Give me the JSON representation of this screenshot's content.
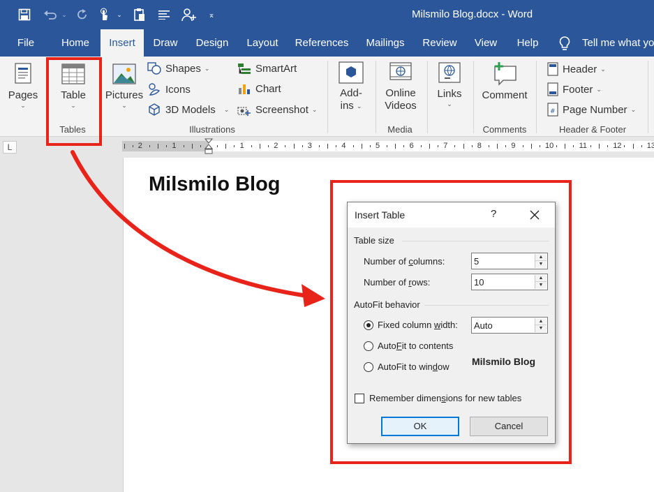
{
  "window": {
    "title": "Milsmilo Blog.docx  -  Word"
  },
  "quick_access": [
    {
      "name": "save-icon"
    },
    {
      "name": "undo-icon"
    },
    {
      "name": "redo-icon"
    },
    {
      "name": "touch-mode-icon"
    },
    {
      "name": "clipboard-icon"
    },
    {
      "name": "paragraph-icon"
    },
    {
      "name": "user-add-icon"
    },
    {
      "name": "customize-icon"
    }
  ],
  "tabs": [
    "File",
    "Home",
    "Insert",
    "Draw",
    "Design",
    "Layout",
    "References",
    "Mailings",
    "Review",
    "View",
    "Help"
  ],
  "active_tab": "Insert",
  "tell_me": "Tell me what yo",
  "ribbon": {
    "pages": "Pages",
    "table": "Table",
    "pictures": "Pictures",
    "shapes": "Shapes",
    "icons": "Icons",
    "models_3d": "3D Models",
    "smartart": "SmartArt",
    "chart": "Chart",
    "screenshot": "Screenshot",
    "addins_line1": "Add-",
    "addins_line2": "ins",
    "online_videos_line1": "Online",
    "online_videos_line2": "Videos",
    "links": "Links",
    "comment": "Comment",
    "header": "Header",
    "footer": "Footer",
    "page_number": "Page Number",
    "groups": {
      "tables": "Tables",
      "illustrations": "Illustrations",
      "media": "Media",
      "comments": "Comments",
      "header_footer": "Header & Footer"
    }
  },
  "ruler": {
    "tab_selector": "L",
    "numbers": [
      "2",
      "1",
      "1",
      "2",
      "3",
      "4",
      "5",
      "6",
      "7",
      "8",
      "9",
      "10",
      "11",
      "12",
      "13"
    ]
  },
  "document": {
    "heading": "Milsmilo Blog"
  },
  "dialog": {
    "title": "Insert Table",
    "help": "?",
    "table_size_label": "Table size",
    "columns_label_pre": "Number of ",
    "columns_label_u": "c",
    "columns_label_post": "olumns:",
    "columns_value": "5",
    "rows_label_pre": "Number of ",
    "rows_label_u": "r",
    "rows_label_post": "ows:",
    "rows_value": "10",
    "autofit_label": "AutoFit behavior",
    "fixed_pre": "Fixed column ",
    "fixed_u": "w",
    "fixed_post": "idth:",
    "fixed_value": "Auto",
    "autofit_contents_pre": "Auto",
    "autofit_contents_u": "F",
    "autofit_contents_post": "it to contents",
    "autofit_window_pre": "AutoFit to win",
    "autofit_window_u": "d",
    "autofit_window_post": "ow",
    "watermark": "Milsmilo Blog",
    "remember": "Remember dimen",
    "remember_u": "s",
    "remember_post": "ions for new tables",
    "ok": "OK",
    "cancel": "Cancel"
  },
  "colors": {
    "ribbon_blue": "#2b579a",
    "highlight_red": "#e8231a",
    "ok_border": "#0078d7"
  }
}
